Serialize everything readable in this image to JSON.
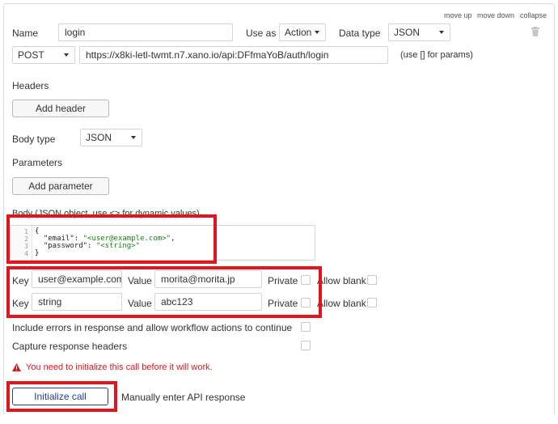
{
  "header_links": {
    "move_up": "move up",
    "move_down": "move down",
    "collapse": "collapse"
  },
  "call": {
    "name_label": "Name",
    "name_value": "login",
    "use_as_label": "Use as",
    "use_as_value": "Action",
    "data_type_label": "Data type",
    "data_type_value": "JSON",
    "method": "POST",
    "url": "https://x8ki-letl-twmt.n7.xano.io/api:DFfmaYoB/auth/login",
    "params_hint": "(use [] for params)"
  },
  "headers": {
    "title": "Headers",
    "add_button": "Add header"
  },
  "body_type": {
    "label": "Body type",
    "value": "JSON"
  },
  "parameters": {
    "title": "Parameters",
    "add_button": "Add parameter"
  },
  "body": {
    "label": "Body (JSON object, use <> for dynamic values)",
    "lines": [
      {
        "num": "1",
        "text": "{"
      },
      {
        "num": "2",
        "key": "\"email\": ",
        "value": "\"<user@example.com>\"",
        "tail": ","
      },
      {
        "num": "3",
        "key": "\"password\": ",
        "value": "\"<string>\"",
        "tail": ""
      },
      {
        "num": "4",
        "text": "}"
      }
    ]
  },
  "dynamic_values": [
    {
      "key_label": "Key",
      "key": "user@example.com",
      "value_label": "Value",
      "value": "morita@morita.jp",
      "private_label": "Private",
      "allow_blank_label": "Allow blank"
    },
    {
      "key_label": "Key",
      "key": "string",
      "value_label": "Value",
      "value": "abc123",
      "private_label": "Private",
      "allow_blank_label": "Allow blank"
    }
  ],
  "options": {
    "include_errors": "Include errors in response and allow workflow actions to continue",
    "capture_headers": "Capture response headers"
  },
  "warning": "You need to initialize this call before it will work.",
  "actions": {
    "initialize": "Initialize call",
    "manual": "Manually enter API response"
  },
  "colors": {
    "highlight": "#e0151d",
    "primary_button": "#1f3f9c",
    "string_literal": "#1a7f1a"
  },
  "icons": {
    "trash": "trash-icon",
    "warning": "warning-icon"
  }
}
